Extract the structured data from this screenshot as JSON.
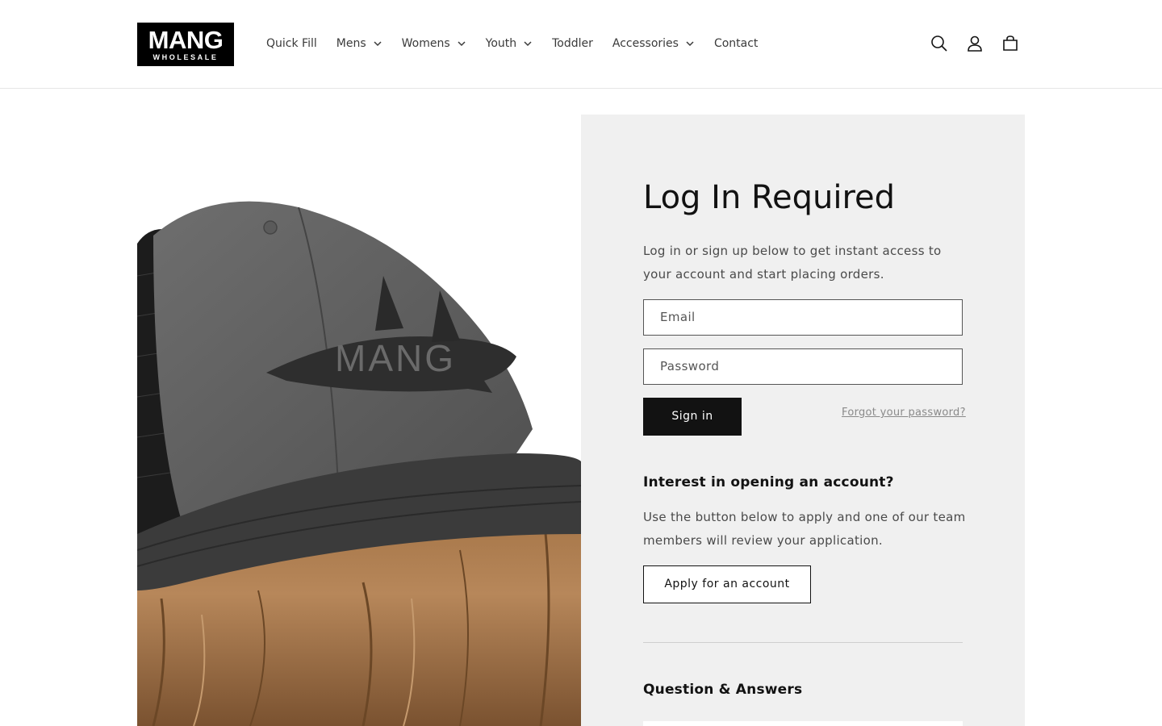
{
  "brand": {
    "name": "MANG",
    "sub": "WHOLESALE"
  },
  "nav": [
    {
      "label": "Quick Fill",
      "dropdown": false
    },
    {
      "label": "Mens",
      "dropdown": true
    },
    {
      "label": "Womens",
      "dropdown": true
    },
    {
      "label": "Youth",
      "dropdown": true
    },
    {
      "label": "Toddler",
      "dropdown": false
    },
    {
      "label": "Accessories",
      "dropdown": true
    },
    {
      "label": "Contact",
      "dropdown": false
    }
  ],
  "header_icons": [
    "search-icon",
    "account-icon",
    "cart-icon"
  ],
  "hero": {
    "hat_logo_text": "MANG"
  },
  "login": {
    "title": "Log In Required",
    "intro": "Log in or sign up below to get instant access to your account and start placing orders.",
    "email_placeholder": "Email",
    "password_placeholder": "Password",
    "signin_label": "Sign in",
    "forgot_label": "Forgot your password?"
  },
  "apply_section": {
    "heading": "Interest in opening an account?",
    "text": "Use the button below to apply and one of our team members will review your application.",
    "button_label": "Apply for an account"
  },
  "qa": {
    "heading": "Question & Answers"
  },
  "colors": {
    "panel_bg": "#f0f0f0",
    "primary_button": "#121212",
    "link": "#8a8a8a"
  }
}
